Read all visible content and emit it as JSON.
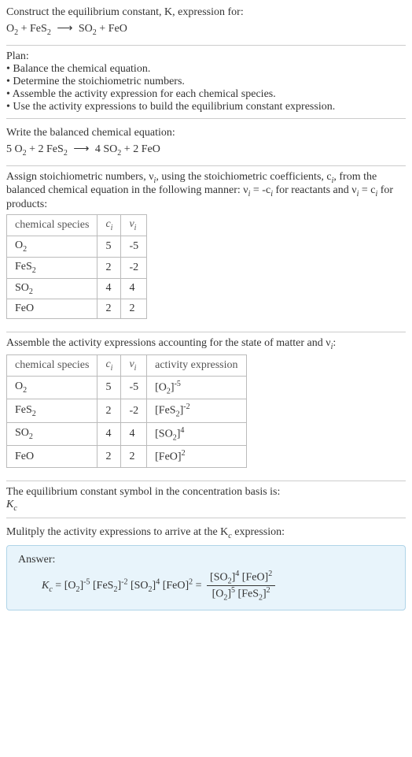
{
  "intro": {
    "line1": "Construct the equilibrium constant, K, expression for:",
    "eq_lhs1": "O",
    "eq_sub1": "2",
    "eq_plus1": " + FeS",
    "eq_sub2": "2",
    "eq_arrow": " ⟶ ",
    "eq_rhs1": "SO",
    "eq_sub3": "2",
    "eq_rhs2": " + FeO"
  },
  "plan": {
    "title": "Plan:",
    "b1": "• Balance the chemical equation.",
    "b2": "• Determine the stoichiometric numbers.",
    "b3": "• Assemble the activity expression for each chemical species.",
    "b4": "• Use the activity expressions to build the equilibrium constant expression."
  },
  "balanced": {
    "title": "Write the balanced chemical equation:",
    "c1": "5 O",
    "s1": "2",
    "c2": " + 2 FeS",
    "s2": "2",
    "arrow": " ⟶ ",
    "c3": "4 SO",
    "s3": "2",
    "c4": " + 2 FeO"
  },
  "stoich": {
    "intro1": "Assign stoichiometric numbers, ν",
    "intro_sub1": "i",
    "intro2": ", using the stoichiometric coefficients, c",
    "intro_sub2": "i",
    "intro3": ", from the balanced chemical equation in the following manner: ν",
    "intro_sub3": "i",
    "intro4": " = -c",
    "intro_sub4": "i",
    "intro5": " for reactants and ν",
    "intro_sub5": "i",
    "intro6": " = c",
    "intro_sub6": "i",
    "intro7": " for products:",
    "h1": "chemical species",
    "h2a": "c",
    "h2b": "i",
    "h3a": "ν",
    "h3b": "i",
    "r1a": "O",
    "r1s": "2",
    "r1c": "5",
    "r1v": "-5",
    "r2a": "FeS",
    "r2s": "2",
    "r2c": "2",
    "r2v": "-2",
    "r3a": "SO",
    "r3s": "2",
    "r3c": "4",
    "r3v": "4",
    "r4a": "FeO",
    "r4c": "2",
    "r4v": "2"
  },
  "activity": {
    "title1": "Assemble the activity expressions accounting for the state of matter and ν",
    "title_sub": "i",
    "title2": ":",
    "h1": "chemical species",
    "h2a": "c",
    "h2b": "i",
    "h3a": "ν",
    "h3b": "i",
    "h4": "activity expression",
    "r1a": "O",
    "r1s": "2",
    "r1c": "5",
    "r1v": "-5",
    "r1e1": "[O",
    "r1e1s": "2",
    "r1e2": "]",
    "r1exp": "-5",
    "r2a": "FeS",
    "r2s": "2",
    "r2c": "2",
    "r2v": "-2",
    "r2e1": "[FeS",
    "r2e1s": "2",
    "r2e2": "]",
    "r2exp": "-2",
    "r3a": "SO",
    "r3s": "2",
    "r3c": "4",
    "r3v": "4",
    "r3e1": "[SO",
    "r3e1s": "2",
    "r3e2": "]",
    "r3exp": "4",
    "r4a": "FeO",
    "r4c": "2",
    "r4v": "2",
    "r4e1": "[FeO]",
    "r4exp": "2"
  },
  "symbol": {
    "line": "The equilibrium constant symbol in the concentration basis is:",
    "k": "K",
    "ksub": "c"
  },
  "final": {
    "title1": "Mulitply the activity expressions to arrive at the K",
    "title_sub": "c",
    "title2": " expression:",
    "answer_label": "Answer:",
    "k": "K",
    "ksub": "c",
    "eq": " = ",
    "t1": "[O",
    "t1s": "2",
    "t1b": "]",
    "t1e": "-5",
    "t2": " [FeS",
    "t2s": "2",
    "t2b": "]",
    "t2e": "-2",
    "t3": " [SO",
    "t3s": "2",
    "t3b": "]",
    "t3e": "4",
    "t4": " [FeO]",
    "t4e": "2",
    "eq2": " = ",
    "n1": "[SO",
    "n1s": "2",
    "n1b": "]",
    "n1e": "4",
    "n2": " [FeO]",
    "n2e": "2",
    "d1": "[O",
    "d1s": "2",
    "d1b": "]",
    "d1e": "5",
    "d2": " [FeS",
    "d2s": "2",
    "d2b": "]",
    "d2e": "2"
  },
  "chart_data": {
    "type": "table",
    "tables": [
      {
        "title": "Stoichiometric numbers",
        "columns": [
          "chemical species",
          "c_i",
          "ν_i"
        ],
        "rows": [
          [
            "O2",
            5,
            -5
          ],
          [
            "FeS2",
            2,
            -2
          ],
          [
            "SO2",
            4,
            4
          ],
          [
            "FeO",
            2,
            2
          ]
        ]
      },
      {
        "title": "Activity expressions",
        "columns": [
          "chemical species",
          "c_i",
          "ν_i",
          "activity expression"
        ],
        "rows": [
          [
            "O2",
            5,
            -5,
            "[O2]^-5"
          ],
          [
            "FeS2",
            2,
            -2,
            "[FeS2]^-2"
          ],
          [
            "SO2",
            4,
            4,
            "[SO2]^4"
          ],
          [
            "FeO",
            2,
            2,
            "[FeO]^2"
          ]
        ]
      }
    ]
  }
}
